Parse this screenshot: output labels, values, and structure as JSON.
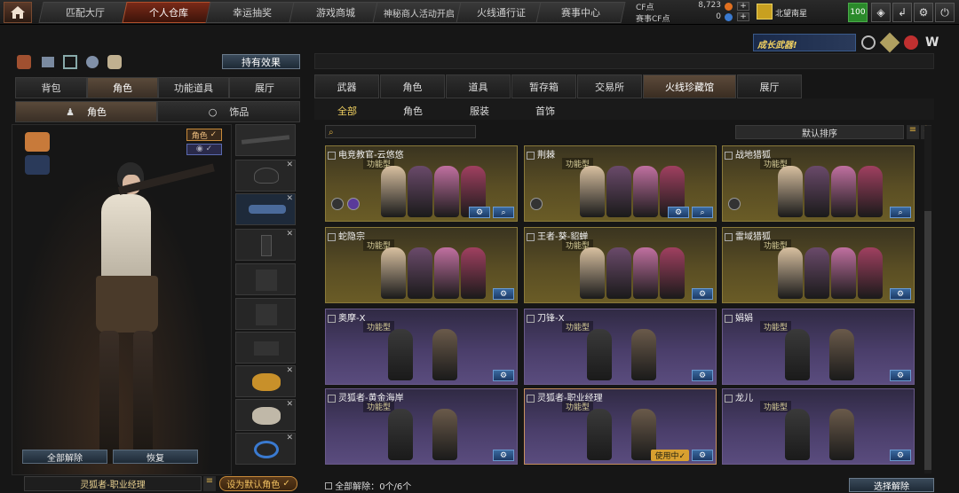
{
  "topnav": {
    "tabs": [
      "匹配大厅",
      "个人仓库",
      "幸运抽奖",
      "游戏商城",
      "神秘商人活动开启",
      "火线通行证",
      "赛事中心"
    ],
    "active": 1
  },
  "currency": {
    "cf_label": "CF点",
    "cf_value": "8,723",
    "event_label": "赛事CF点",
    "event_value": "0"
  },
  "user": {
    "name": "北望南星",
    "level": "100"
  },
  "banner": {
    "text": "成长武器!"
  },
  "left": {
    "effects_button": "持有效果",
    "tabs": [
      "背包",
      "角色",
      "功能道具",
      "展厅"
    ],
    "active_tab": 1,
    "subtabs": [
      "角色",
      "饰品"
    ],
    "toggle_label": "角色",
    "unequip_all": "全部解除",
    "restore": "恢复",
    "current_name": "灵狐者-职业经理",
    "set_default": "设为默认角色"
  },
  "right": {
    "tabs": [
      "武器",
      "角色",
      "道具",
      "暂存箱",
      "交易所",
      "火线珍藏馆",
      "展厅"
    ],
    "active_tab": 5,
    "filters": [
      "全部",
      "角色",
      "服装",
      "首饰"
    ],
    "active_filter": 0,
    "sort_label": "默认排序",
    "cards": [
      {
        "title": "电竞教官-云悠悠",
        "tag": "功能型",
        "theme": "gold",
        "badges": 2,
        "buttons": 2
      },
      {
        "title": "荆棘",
        "tag": "功能型",
        "theme": "gold",
        "badges": 1,
        "buttons": 2
      },
      {
        "title": "战地猎狐",
        "tag": "功能型",
        "theme": "gold",
        "badges": 1,
        "buttons": 1
      },
      {
        "title": "蛇隐宗",
        "tag": "功能型",
        "theme": "gold",
        "badges": 0,
        "buttons": 1
      },
      {
        "title": "王者-葵-貂蝉",
        "tag": "功能型",
        "theme": "gold",
        "badges": 0,
        "buttons": 1
      },
      {
        "title": "雷域猎狐",
        "tag": "功能型",
        "theme": "gold",
        "badges": 0,
        "buttons": 1
      },
      {
        "title": "奥摩-X",
        "tag": "功能型",
        "theme": "purple",
        "badges": 0,
        "buttons": 1
      },
      {
        "title": "刀锋-X",
        "tag": "功能型",
        "theme": "purple",
        "badges": 0,
        "buttons": 1
      },
      {
        "title": "娟娟",
        "tag": "功能型",
        "theme": "purple",
        "badges": 0,
        "buttons": 1
      },
      {
        "title": "灵狐者-黄金海岸",
        "tag": "功能型",
        "theme": "purple",
        "badges": 0,
        "buttons": 1
      },
      {
        "title": "灵狐者-职业经理",
        "tag": "功能型",
        "theme": "purple",
        "badges": 0,
        "buttons": 1,
        "in_use": "使用中✓",
        "selected": true
      },
      {
        "title": "龙儿",
        "tag": "功能型",
        "theme": "purple",
        "badges": 0,
        "buttons": 1
      }
    ],
    "footer_label": "全部解除：",
    "footer_count": "0个/6个",
    "select_unequip": "选择解除"
  }
}
